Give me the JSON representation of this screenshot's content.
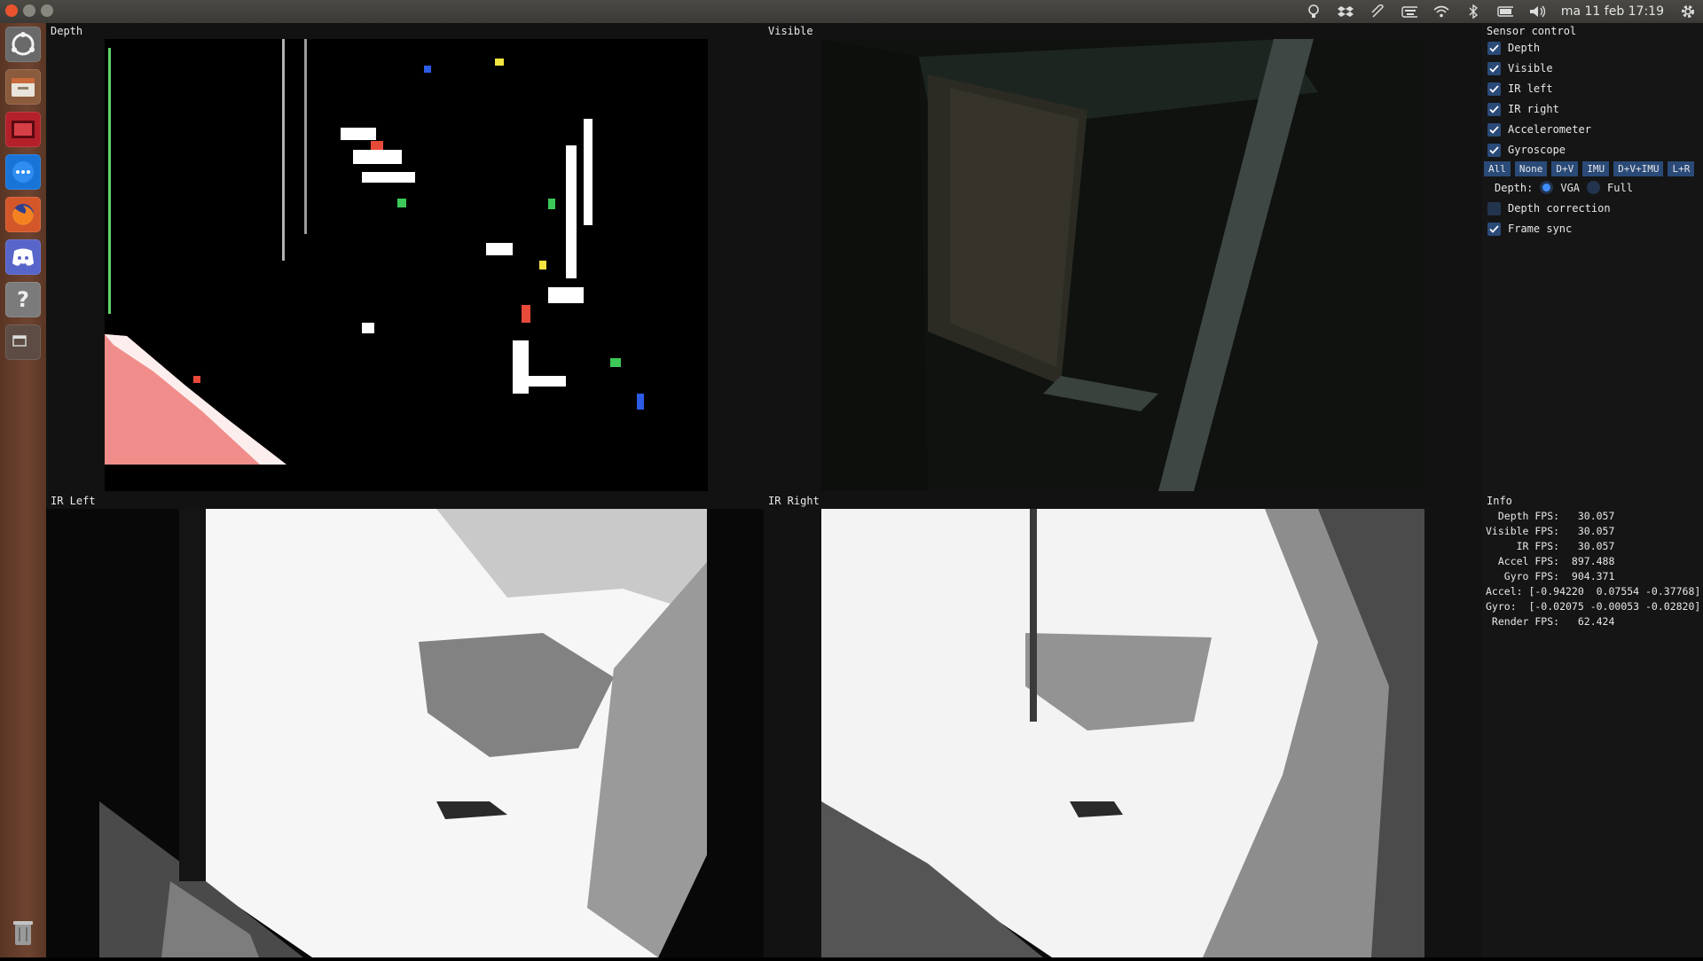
{
  "topbar": {
    "datetime": "ma 11 feb 17:19",
    "tray_icons": [
      "bulb-icon",
      "dropbox-icon",
      "paperclip-icon",
      "keyboard-icon",
      "wifi-icon",
      "bluetooth-icon",
      "battery-icon",
      "volume-icon"
    ]
  },
  "launcher": {
    "items": [
      "ubuntu-dash-icon",
      "files-icon",
      "app-red-icon",
      "messenger-icon",
      "firefox-icon",
      "discord-icon",
      "help-icon",
      "window-icon",
      "trash-icon"
    ]
  },
  "panels": {
    "depth": "Depth",
    "visible": "Visible",
    "ir_left": "IR Left",
    "ir_right": "IR Right"
  },
  "sensor_control": {
    "title": "Sensor control",
    "checks": [
      {
        "label": "Depth",
        "checked": true
      },
      {
        "label": "Visible",
        "checked": true
      },
      {
        "label": "IR left",
        "checked": true
      },
      {
        "label": "IR right",
        "checked": true
      },
      {
        "label": "Accelerometer",
        "checked": true
      },
      {
        "label": "Gyroscope",
        "checked": true
      }
    ],
    "buttons": [
      "All",
      "None",
      "D+V",
      "IMU",
      "D+V+IMU",
      "L+R"
    ],
    "depth_label": "Depth:",
    "radio_vga": "VGA",
    "radio_full": "Full",
    "depth_correction": "Depth correction",
    "frame_sync": "Frame sync"
  },
  "info": {
    "title": "Info",
    "lines": [
      "  Depth FPS:   30.057",
      "Visible FPS:   30.057",
      "     IR FPS:   30.057",
      "  Accel FPS:  897.488",
      "   Gyro FPS:  904.371",
      "Accel: [-0.94220  0.07554 -0.37768]",
      "Gyro:  [-0.02075 -0.00053 -0.02820]",
      " Render FPS:   62.424"
    ]
  }
}
